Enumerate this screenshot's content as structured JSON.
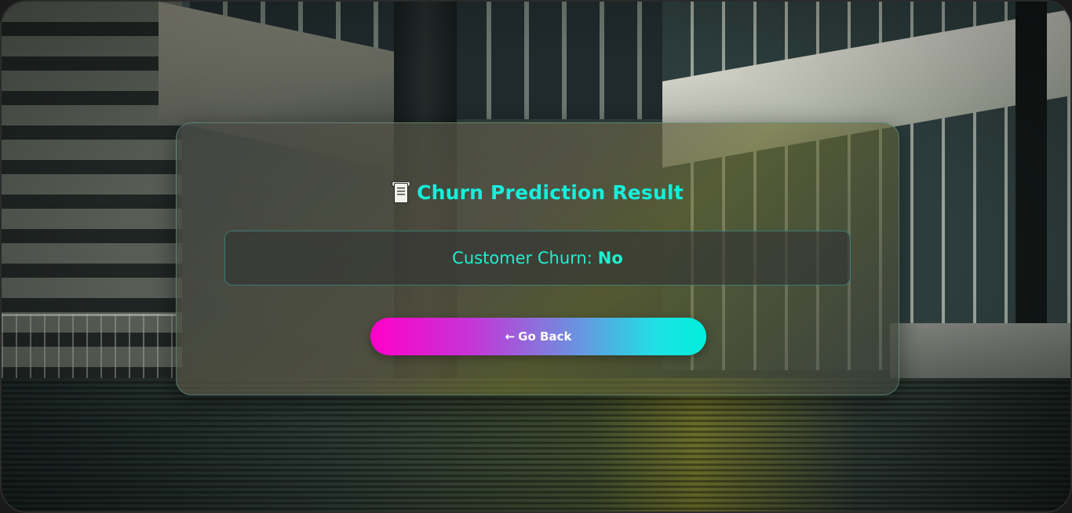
{
  "card": {
    "title": "Churn Prediction Result",
    "title_icon": "scroll-icon"
  },
  "result": {
    "label": "Customer Churn:",
    "value": "No"
  },
  "back_button": {
    "arrow": "←",
    "label": "Go Back"
  },
  "colors": {
    "accent": "#14f0dc",
    "button_gradient_start": "#ff00c8",
    "button_gradient_end": "#00f0dc"
  }
}
